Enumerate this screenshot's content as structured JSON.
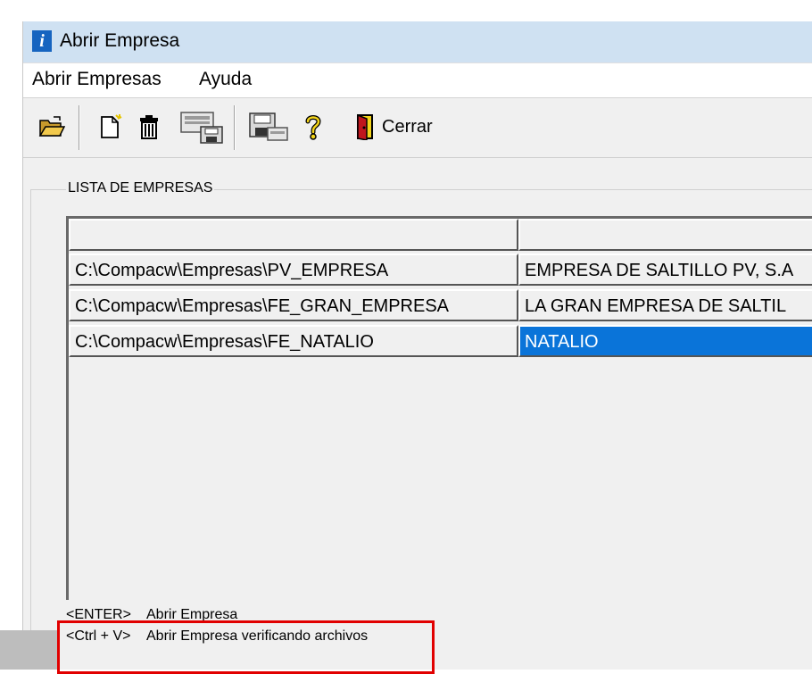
{
  "window": {
    "title": "Abrir Empresa"
  },
  "menu": {
    "items": [
      "Abrir Empresas",
      "Ayuda"
    ]
  },
  "toolbar": {
    "close_label": "Cerrar"
  },
  "group": {
    "label": "LISTA DE EMPRESAS"
  },
  "table": {
    "headers": [
      "",
      ""
    ],
    "rows": [
      {
        "path": "C:\\Compacw\\Empresas\\PV_EMPRESA",
        "name": "EMPRESA DE SALTILLO PV, S.A"
      },
      {
        "path": "C:\\Compacw\\Empresas\\FE_GRAN_EMPRESA",
        "name": "LA GRAN EMPRESA DE SALTIL"
      },
      {
        "path": "C:\\Compacw\\Empresas\\FE_NATALIO",
        "name": "NATALIO"
      }
    ],
    "selected_row": 2
  },
  "hints": [
    {
      "key": "<ENTER>",
      "action": "Abrir Empresa"
    },
    {
      "key": "<Ctrl + V>",
      "action": "Abrir Empresa verificando archivos"
    }
  ],
  "colors": {
    "selection": "#0a74d9",
    "highlight_box": "#e10000",
    "titlebar": "#cfe1f2"
  }
}
